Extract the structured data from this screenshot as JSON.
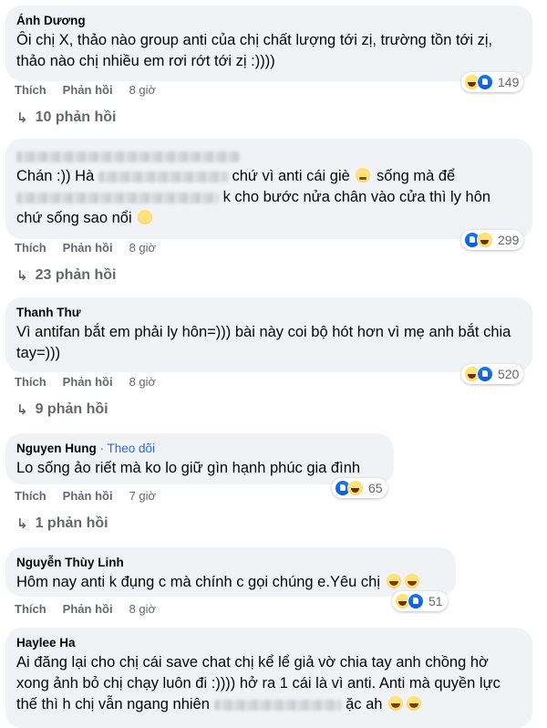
{
  "actions": {
    "like": "Thích",
    "reply": "Phản hồi"
  },
  "comments": [
    {
      "author": "Ánh Dương",
      "text": "Ôi chị X, thảo nào group anti của chị chất lượng tới zị, trường tồn tới zị, thảo nào chị nhiều em rơi rớt tới zị :))))",
      "time": "8 giờ",
      "reaction_count": "149",
      "replies": "10 phản hồi"
    },
    {
      "author": "",
      "text_line1_a": "Chán :)) Hà",
      "text_line1_b": "chứ vì anti cái giè",
      "text_line1_c": "sống mà để",
      "text_line2": "k cho bước nửa chân vào cửa thì ly hôn",
      "text_line3": "chứ sống sao nổi",
      "time": "8 giờ",
      "reaction_count": "299",
      "replies": "23 phản hồi"
    },
    {
      "author": "Thanh Thư",
      "text": "Vì antifan bắt em phải ly hôn=))) bài này coi bộ hót hơn vì mẹ anh bắt chia tay=)))",
      "time": "8 giờ",
      "reaction_count": "520",
      "replies": "9 phản hồi"
    },
    {
      "author": "Nguyen Hung",
      "follow_sep": " · ",
      "follow": "Theo dõi",
      "text": "Lo sống ảo riết mà ko lo giữ gìn hạnh phúc gia đình",
      "time": "7 giờ",
      "reaction_count": "65",
      "replies": "1 phản hồi"
    },
    {
      "author": "Nguyễn Thùy Linh",
      "text": "Hôm nay anti k đụng c mà chính c gọi chúng e.Yêu chị",
      "time": "8 giờ",
      "reaction_count": "51"
    },
    {
      "author": "Haylee Ha",
      "text_a": "Ai đăng lại cho chị cái save chat chị kể lể giả vờ chia tay anh chồng hờ xong ảnh bỏ chị chạy luôn đi :)))) hở ra 1 cái là vì anti. Anti mà quyền lực thế thì h chị vẫn ngang nhiên",
      "text_b": "ặc ah"
    }
  ]
}
